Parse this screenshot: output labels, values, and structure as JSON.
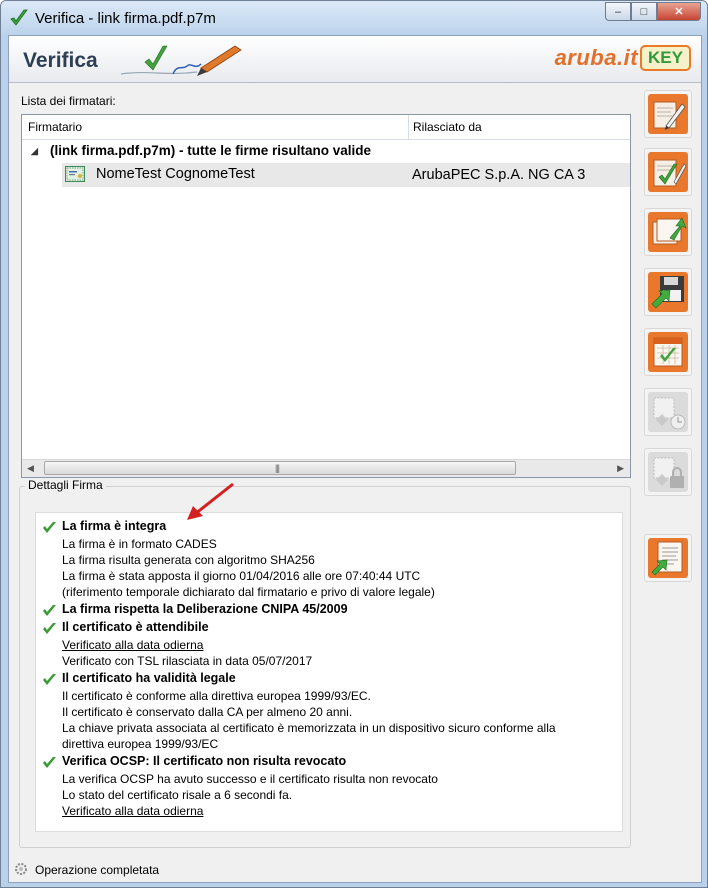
{
  "window": {
    "title": "Verifica - link firma.pdf.p7m",
    "minimize_glyph": "–",
    "maximize_glyph": "□",
    "close_glyph": "✕"
  },
  "banner": {
    "title": "Verifica",
    "brand_name": "aruba.it",
    "brand_key": "KEY"
  },
  "signers": {
    "label": "Lista dei firmatari:",
    "columns": [
      "Firmatario",
      "Rilasciato da"
    ],
    "group_text": "(link firma.pdf.p7m)  - tutte le firme risultano valide",
    "rows": [
      {
        "name": "NomeTest CognomeTest",
        "issuer": "ArubaPEC S.p.A. NG CA 3"
      }
    ],
    "scroll_grip": "|||"
  },
  "toolbar": {
    "buttons": [
      {
        "name": "sign-document",
        "icon": "pen-document-icon",
        "enabled": true
      },
      {
        "name": "verify-signature",
        "icon": "check-document-icon",
        "enabled": true
      },
      {
        "name": "export-document",
        "icon": "export-arrow-icon",
        "enabled": true
      },
      {
        "name": "save-document",
        "icon": "floppy-arrow-icon",
        "enabled": true
      },
      {
        "name": "verify-at-date",
        "icon": "calendar-check-icon",
        "enabled": true
      },
      {
        "name": "timestamp-certificate",
        "icon": "clock-certificate-icon",
        "enabled": false
      },
      {
        "name": "lock-certificate",
        "icon": "padlock-certificate-icon",
        "enabled": false
      },
      {
        "name": "view-report",
        "icon": "report-arrow-icon",
        "enabled": true
      }
    ]
  },
  "details": {
    "label": "Dettagli Firma",
    "lines": [
      {
        "text": "La firma è integra",
        "kind": "head"
      },
      {
        "text": "La firma è in formato CADES",
        "kind": "text"
      },
      {
        "text": "La firma risulta generata con algoritmo SHA256",
        "kind": "text"
      },
      {
        "text": "La firma è stata apposta il giorno 01/04/2016 alle ore 07:40:44 UTC",
        "kind": "text"
      },
      {
        "text": "(riferimento temporale dichiarato dal firmatario e privo di valore legale)",
        "kind": "text"
      },
      {
        "text": "La firma rispetta la Deliberazione CNIPA 45/2009",
        "kind": "head"
      },
      {
        "text": "Il certificato è attendibile",
        "kind": "head"
      },
      {
        "text": "Verificato alla data odierna",
        "kind": "link"
      },
      {
        "text": "Verificato con TSL rilasciata in data 05/07/2017",
        "kind": "text"
      },
      {
        "text": "Il certificato ha validità legale",
        "kind": "head"
      },
      {
        "text": "Il certificato è conforme alla direttiva europea 1999/93/EC.",
        "kind": "text"
      },
      {
        "text": "Il certificato è conservato dalla CA per almeno 20 anni.",
        "kind": "text"
      },
      {
        "text": "La chiave privata associata al certificato è memorizzata in un dispositivo sicuro conforme alla",
        "kind": "text"
      },
      {
        "text": "direttiva europea 1999/93/EC",
        "kind": "text"
      },
      {
        "text": "Verifica OCSP: Il certificato non risulta revocato",
        "kind": "head"
      },
      {
        "text": "La verifica OCSP ha avuto successo e il certificato risulta non revocato",
        "kind": "text"
      },
      {
        "text": "Lo stato del certificato risale a 6 secondi fa.",
        "kind": "text"
      },
      {
        "text": "Verificato alla data odierna",
        "kind": "link"
      }
    ]
  },
  "status": {
    "text": "Operazione completata"
  },
  "colors": {
    "accent_orange": "#e9782c",
    "check_green": "#3c9a35",
    "annotation_red": "#d42020"
  }
}
